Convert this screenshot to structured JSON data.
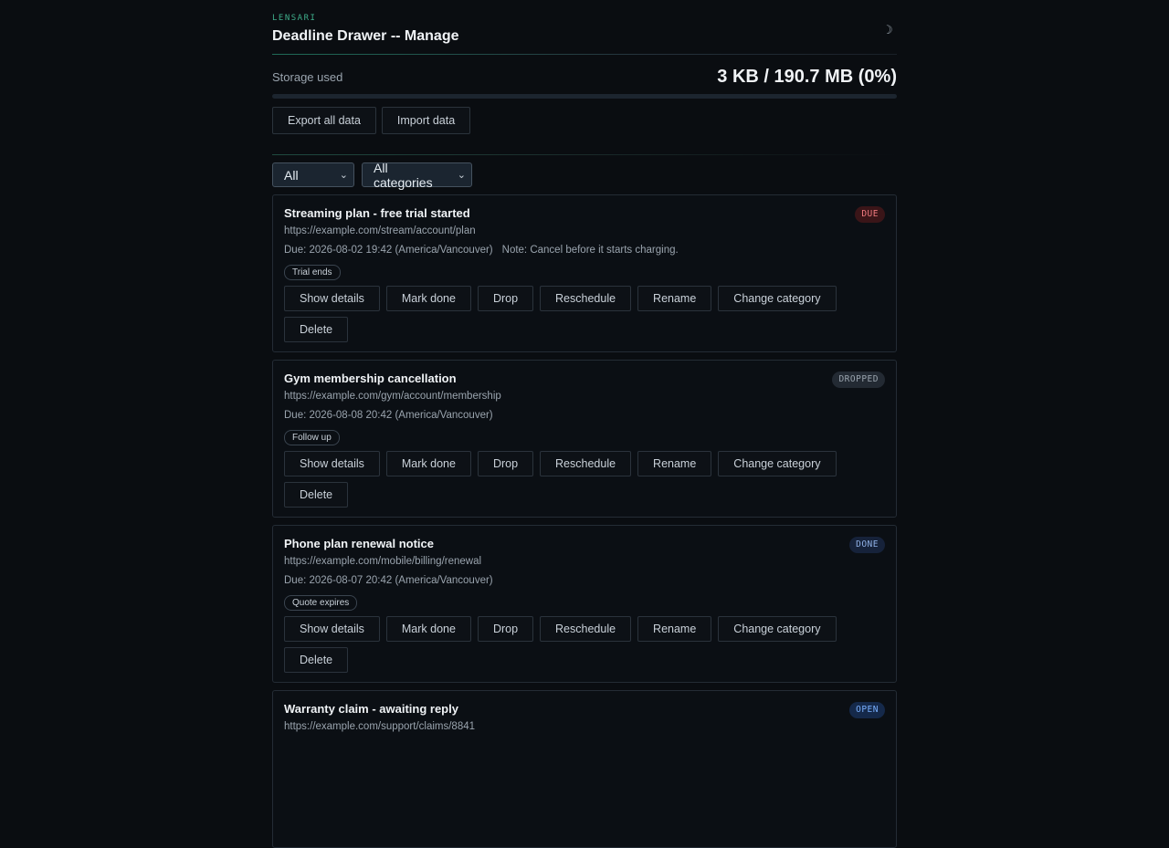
{
  "app": {
    "brand": "LENSARI",
    "title": "Deadline Drawer -- Manage",
    "theme_icon": "moon-icon",
    "theme_glyph": "☽"
  },
  "storage": {
    "label": "Storage used",
    "value": "3 KB / 190.7 MB (0%)",
    "percent": 0
  },
  "toolbar": {
    "export_label": "Export all data",
    "import_label": "Import data"
  },
  "filters": {
    "status_selected": "All",
    "category_selected": "All categories"
  },
  "actions": {
    "show_details": "Show details",
    "mark_done": "Mark done",
    "drop": "Drop",
    "reschedule": "Reschedule",
    "rename": "Rename",
    "change_category": "Change category",
    "delete": "Delete"
  },
  "items": [
    {
      "title": "Streaming plan - free trial started",
      "url": "https://example.com/stream/account/plan",
      "due": "Due: 2026-08-02 19:42 (America/Vancouver)",
      "note": "Note: Cancel before it starts charging.",
      "tag": "Trial ends",
      "status": "DUE",
      "status_color": "#f07a7f"
    },
    {
      "title": "Gym membership cancellation",
      "url": "https://example.com/gym/account/membership",
      "due": "Due: 2026-08-08 20:42 (America/Vancouver)",
      "note": "",
      "tag": "Follow up",
      "status": "DROPPED",
      "status_color": "#9aa4ae"
    },
    {
      "title": "Phone plan renewal notice",
      "url": "https://example.com/mobile/billing/renewal",
      "due": "Due: 2026-08-07 20:42 (America/Vancouver)",
      "note": "",
      "tag": "Quote expires",
      "status": "DONE",
      "status_color": "#8fb0e6"
    },
    {
      "title": "Warranty claim - awaiting reply",
      "url": "https://example.com/support/claims/8841",
      "due": "",
      "note": "",
      "tag": "",
      "status": "OPEN",
      "status_color": "#79b0ff"
    }
  ]
}
